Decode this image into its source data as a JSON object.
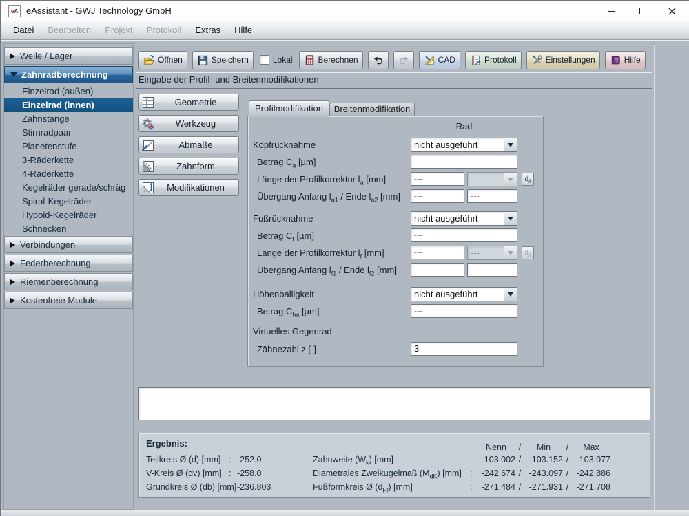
{
  "window": {
    "title": "eAssistant - GWJ Technology GmbH",
    "icon_text": "eA"
  },
  "menu": {
    "items": [
      {
        "label": [
          {
            "u": "D"
          },
          {
            "text": "atei"
          }
        ],
        "enabled": true
      },
      {
        "label": [
          {
            "u": "B"
          },
          {
            "text": "earbeiten"
          }
        ],
        "enabled": false
      },
      {
        "label": [
          {
            "u": "P"
          },
          {
            "text": "rojekt"
          }
        ],
        "enabled": false
      },
      {
        "label": [
          {
            "text": "P"
          },
          {
            "u": "r"
          },
          {
            "text": "otokoll"
          }
        ],
        "enabled": false
      },
      {
        "label": [
          {
            "text": "E"
          },
          {
            "u": "x"
          },
          {
            "text": "tras"
          }
        ],
        "enabled": true
      },
      {
        "label": [
          {
            "u": "H"
          },
          {
            "text": "ilfe"
          }
        ],
        "enabled": true
      }
    ]
  },
  "sidebar": {
    "sections": [
      {
        "label": "Welle / Lager",
        "state": "collapsed"
      },
      {
        "label": "Zahnradberechnung",
        "state": "expanded",
        "items": [
          {
            "label": "Einzelrad (außen)",
            "selected": false
          },
          {
            "label": "Einzelrad (innen)",
            "selected": true
          },
          {
            "label": "Zahnstange",
            "selected": false
          },
          {
            "label": "Stirnradpaar",
            "selected": false
          },
          {
            "label": "Planetenstufe",
            "selected": false
          },
          {
            "label": "3-Räderkette",
            "selected": false
          },
          {
            "label": "4-Räderkette",
            "selected": false
          },
          {
            "label": "Kegelräder gerade/schräg",
            "selected": false
          },
          {
            "label": "Spiral-Kegelräder",
            "selected": false
          },
          {
            "label": "Hypoid-Kegelräder",
            "selected": false
          },
          {
            "label": "Schnecken",
            "selected": false
          }
        ]
      },
      {
        "label": "Verbindungen",
        "state": "collapsed"
      },
      {
        "label": "Federberechnung",
        "state": "collapsed"
      },
      {
        "label": "Riemenberechnung",
        "state": "collapsed"
      },
      {
        "label": "Kostenfreie Module",
        "state": "collapsed"
      }
    ]
  },
  "toolbar": {
    "open": "Öffnen",
    "save": "Speichern",
    "lokal": "Lokal",
    "lokal_checked": false,
    "calc": "Berechnen",
    "cad": "CAD",
    "protokoll": "Protokoll",
    "settings": "Einstellungen",
    "help": "Hilfe",
    "icons": {
      "open": "folder-open",
      "save": "floppy-disk",
      "calc": "calculator",
      "undo": "undo-arrow",
      "redo": "redo-arrow",
      "cad": "set-square-pencil",
      "protokoll": "document",
      "settings": "tools",
      "help": "book"
    }
  },
  "page_header": "Eingabe der Profil- und Breitenmodifikationen",
  "nav_buttons": [
    {
      "label": "Geometrie",
      "icon": "grid"
    },
    {
      "label": "Werkzeug",
      "icon": "gear-pencils"
    },
    {
      "label": "Abmaße",
      "icon": "sheet-pencil"
    },
    {
      "label": "Zahnform",
      "icon": "gear-sector"
    },
    {
      "label": "Modifikationen",
      "icon": "hatched-arrows"
    }
  ],
  "tabs": [
    {
      "label": "Profilmodifikation",
      "active": true
    },
    {
      "label": "Breitenmodifikation",
      "active": false
    }
  ],
  "form": {
    "col_header": "Rad",
    "kopfruecknahme": {
      "label": [
        {
          "text": "Kopfrücknahme"
        }
      ],
      "value": "nicht ausgeführt"
    },
    "betrag_ca": {
      "label": [
        {
          "text": "Betrag C"
        },
        {
          "sub": "a"
        },
        {
          "text": " [µm]"
        }
      ],
      "value": "---"
    },
    "laenge_la": {
      "label": [
        {
          "text": "Länge der Profilkorrektur l"
        },
        {
          "sub": "a"
        },
        {
          "text": " [mm]"
        }
      ],
      "value1": "---",
      "value2": "---"
    },
    "uebergang_a": {
      "label": [
        {
          "text": "Übergang Anfang l"
        },
        {
          "sub": "a1"
        },
        {
          "text": " / Ende l"
        },
        {
          "sub": "a2"
        },
        {
          "text": " [mm]"
        }
      ],
      "value1": "---",
      "value2": "---"
    },
    "fussruecknahme": {
      "label": [
        {
          "text": "Fußrücknahme"
        }
      ],
      "value": "nicht ausgeführt"
    },
    "betrag_cf": {
      "label": [
        {
          "text": "Betrag C"
        },
        {
          "sub": "f"
        },
        {
          "text": " [µm]"
        }
      ],
      "value": "---"
    },
    "laenge_lf": {
      "label": [
        {
          "text": "Länge der Profilkorrektur l"
        },
        {
          "sub": "f"
        },
        {
          "text": " [mm]"
        }
      ],
      "value1": "---",
      "value2": "---"
    },
    "uebergang_f": {
      "label": [
        {
          "text": "Übergang Anfang l"
        },
        {
          "sub": "f1"
        },
        {
          "text": " / Ende l"
        },
        {
          "sub": "f2"
        },
        {
          "text": " [mm]"
        }
      ],
      "value1": "---",
      "value2": "---"
    },
    "hoehenballigkeit": {
      "label": [
        {
          "text": "Höhenballigkeit"
        }
      ],
      "value": "nicht ausgeführt"
    },
    "betrag_cha": {
      "label": [
        {
          "text": "Betrag C"
        },
        {
          "sub": "ha"
        },
        {
          "text": " [µm]"
        }
      ],
      "value": "---"
    },
    "virtuelles_gegenrad": {
      "label": [
        {
          "text": "Virtuelles Gegenrad"
        }
      ]
    },
    "zaehnezahl": {
      "label": [
        {
          "text": "Zähnezahl z [-]"
        }
      ],
      "value": "3"
    },
    "dl_label": [
      {
        "text": "d"
      },
      {
        "sub": "/l"
      }
    ]
  },
  "results": {
    "title": "Ergebnis:",
    "cols": {
      "nenn": "Nenn",
      "min": "Min",
      "max": "Max",
      "sep": "/",
      "colon": ":"
    },
    "rows": [
      {
        "l_label": [
          {
            "text": "Teilkreis Ø (d) [mm]"
          }
        ],
        "l_value": "-252.0",
        "r_label": [
          {
            "text": "Zahnweite (W"
          },
          {
            "sub": "k"
          },
          {
            "text": ") [mm]"
          }
        ],
        "nenn": "-103.002",
        "min": "-103.152",
        "max": "-103.077"
      },
      {
        "l_label": [
          {
            "text": "V-Kreis Ø (dv) [mm]"
          }
        ],
        "l_value": "-258.0",
        "r_label": [
          {
            "text": "Diametrales Zweikugelmaß (M"
          },
          {
            "sub": "dK"
          },
          {
            "text": ") [mm]"
          }
        ],
        "nenn": "-242.674",
        "min": "-243.097",
        "max": "-242.886"
      },
      {
        "l_label": [
          {
            "text": "Grundkreis Ø (db) [mm]"
          }
        ],
        "l_value": "-236.803",
        "r_label": [
          {
            "text": "Fußformkreis Ø (d"
          },
          {
            "sub": "Ff"
          },
          {
            "text": ") [mm]"
          }
        ],
        "nenn": "-271.484",
        "min": "-271.931",
        "max": "-271.708"
      }
    ]
  },
  "colors": {
    "background": "#b0b9c1",
    "selected_item": "#12507e",
    "section_header_blue_top": "#8cb2d4",
    "section_header_blue_bottom": "#1d578c",
    "results_background": "#c9d1d8"
  }
}
